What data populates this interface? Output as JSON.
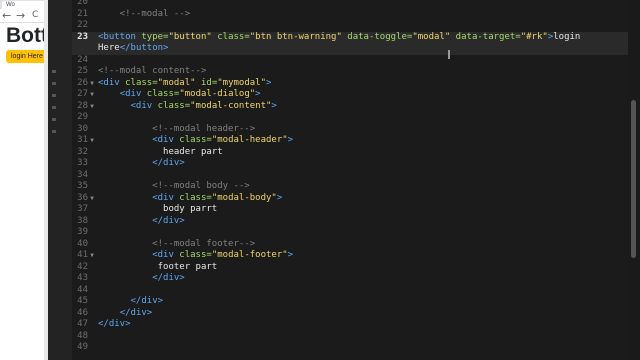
{
  "browser": {
    "tab_label": "Wo",
    "nav_back": "←",
    "nav_forward": "→",
    "nav_reload": "C",
    "page_title": "Botts",
    "button_label": "login Here",
    "accent_color": "#ffc107"
  },
  "editor": {
    "current_line": 23,
    "lines": [
      {
        "n": "20",
        "fold": "",
        "tokens": []
      },
      {
        "n": "21",
        "fold": "",
        "tokens": [
          {
            "c": "com",
            "t": "    <!--modal -->"
          }
        ]
      },
      {
        "n": "22",
        "fold": "",
        "tokens": []
      },
      {
        "n": "23",
        "fold": "",
        "tokens": [
          {
            "c": "tag",
            "t": "<button"
          },
          {
            "c": "attr",
            "t": " type="
          },
          {
            "c": "str",
            "t": "\"button\""
          },
          {
            "c": "attr",
            "t": " class="
          },
          {
            "c": "str",
            "t": "\"btn btn-warning\""
          },
          {
            "c": "attr",
            "t": " data-toggle="
          },
          {
            "c": "str",
            "t": "\"modal\""
          },
          {
            "c": "attr",
            "t": " data-target="
          },
          {
            "c": "str",
            "t": "\"#rk\""
          },
          {
            "c": "tag",
            "t": ">"
          },
          {
            "c": "txt",
            "t": "login"
          }
        ]
      },
      {
        "n": "",
        "fold": "",
        "tokens": [
          {
            "c": "txt",
            "t": "Here"
          },
          {
            "c": "tag",
            "t": "</button>"
          }
        ]
      },
      {
        "n": "24",
        "fold": "",
        "tokens": []
      },
      {
        "n": "25",
        "fold": "",
        "tokens": [
          {
            "c": "com",
            "t": "<!--modal content-->"
          }
        ]
      },
      {
        "n": "26",
        "fold": "▼",
        "tokens": [
          {
            "c": "tag",
            "t": "<div"
          },
          {
            "c": "attr",
            "t": " class="
          },
          {
            "c": "str",
            "t": "\"modal\""
          },
          {
            "c": "attr",
            "t": " id="
          },
          {
            "c": "str",
            "t": "\"mymodal\""
          },
          {
            "c": "tag",
            "t": ">"
          }
        ]
      },
      {
        "n": "27",
        "fold": "▼",
        "tokens": [
          {
            "c": "txt",
            "t": "    "
          },
          {
            "c": "tag",
            "t": "<div"
          },
          {
            "c": "attr",
            "t": " class="
          },
          {
            "c": "str",
            "t": "\"modal-dialog\""
          },
          {
            "c": "tag",
            "t": ">"
          }
        ]
      },
      {
        "n": "28",
        "fold": "▼",
        "tokens": [
          {
            "c": "txt",
            "t": "      "
          },
          {
            "c": "tag",
            "t": "<div"
          },
          {
            "c": "attr",
            "t": " class="
          },
          {
            "c": "str",
            "t": "\"modal-content\""
          },
          {
            "c": "tag",
            "t": ">"
          }
        ]
      },
      {
        "n": "29",
        "fold": "",
        "tokens": []
      },
      {
        "n": "30",
        "fold": "",
        "tokens": [
          {
            "c": "com",
            "t": "          <!--modal header-->"
          }
        ]
      },
      {
        "n": "31",
        "fold": "▼",
        "tokens": [
          {
            "c": "txt",
            "t": "          "
          },
          {
            "c": "tag",
            "t": "<div"
          },
          {
            "c": "attr",
            "t": " class="
          },
          {
            "c": "str",
            "t": "\"modal-header\""
          },
          {
            "c": "tag",
            "t": ">"
          }
        ]
      },
      {
        "n": "32",
        "fold": "",
        "tokens": [
          {
            "c": "txt",
            "t": "            header part"
          }
        ]
      },
      {
        "n": "33",
        "fold": "",
        "tokens": [
          {
            "c": "txt",
            "t": "          "
          },
          {
            "c": "tag",
            "t": "</div>"
          }
        ]
      },
      {
        "n": "34",
        "fold": "",
        "tokens": []
      },
      {
        "n": "35",
        "fold": "",
        "tokens": [
          {
            "c": "com",
            "t": "          <!--modal body -->"
          }
        ]
      },
      {
        "n": "36",
        "fold": "▼",
        "tokens": [
          {
            "c": "txt",
            "t": "          "
          },
          {
            "c": "tag",
            "t": "<div"
          },
          {
            "c": "attr",
            "t": " class="
          },
          {
            "c": "str",
            "t": "\"modal-body\""
          },
          {
            "c": "tag",
            "t": ">"
          }
        ]
      },
      {
        "n": "37",
        "fold": "",
        "tokens": [
          {
            "c": "txt",
            "t": "            body parrt"
          }
        ]
      },
      {
        "n": "38",
        "fold": "",
        "tokens": [
          {
            "c": "txt",
            "t": "          "
          },
          {
            "c": "tag",
            "t": "</div>"
          }
        ]
      },
      {
        "n": "39",
        "fold": "",
        "tokens": []
      },
      {
        "n": "40",
        "fold": "",
        "tokens": [
          {
            "c": "com",
            "t": "          <!--modal footer-->"
          }
        ]
      },
      {
        "n": "41",
        "fold": "▼",
        "tokens": [
          {
            "c": "txt",
            "t": "          "
          },
          {
            "c": "tag",
            "t": "<div"
          },
          {
            "c": "attr",
            "t": " class="
          },
          {
            "c": "str",
            "t": "\"modal-footer\""
          },
          {
            "c": "tag",
            "t": ">"
          }
        ]
      },
      {
        "n": "42",
        "fold": "",
        "tokens": [
          {
            "c": "txt",
            "t": "           footer part"
          }
        ]
      },
      {
        "n": "43",
        "fold": "",
        "tokens": [
          {
            "c": "txt",
            "t": "          "
          },
          {
            "c": "tag",
            "t": "</div>"
          }
        ]
      },
      {
        "n": "44",
        "fold": "",
        "tokens": []
      },
      {
        "n": "45",
        "fold": "",
        "tokens": [
          {
            "c": "txt",
            "t": "      "
          },
          {
            "c": "tag",
            "t": "</div>"
          }
        ]
      },
      {
        "n": "46",
        "fold": "",
        "tokens": [
          {
            "c": "txt",
            "t": "    "
          },
          {
            "c": "tag",
            "t": "</div>"
          }
        ]
      },
      {
        "n": "47",
        "fold": "",
        "tokens": [
          {
            "c": "tag",
            "t": "</div>"
          }
        ]
      },
      {
        "n": "48",
        "fold": "",
        "tokens": []
      },
      {
        "n": "49",
        "fold": "",
        "tokens": []
      }
    ]
  }
}
